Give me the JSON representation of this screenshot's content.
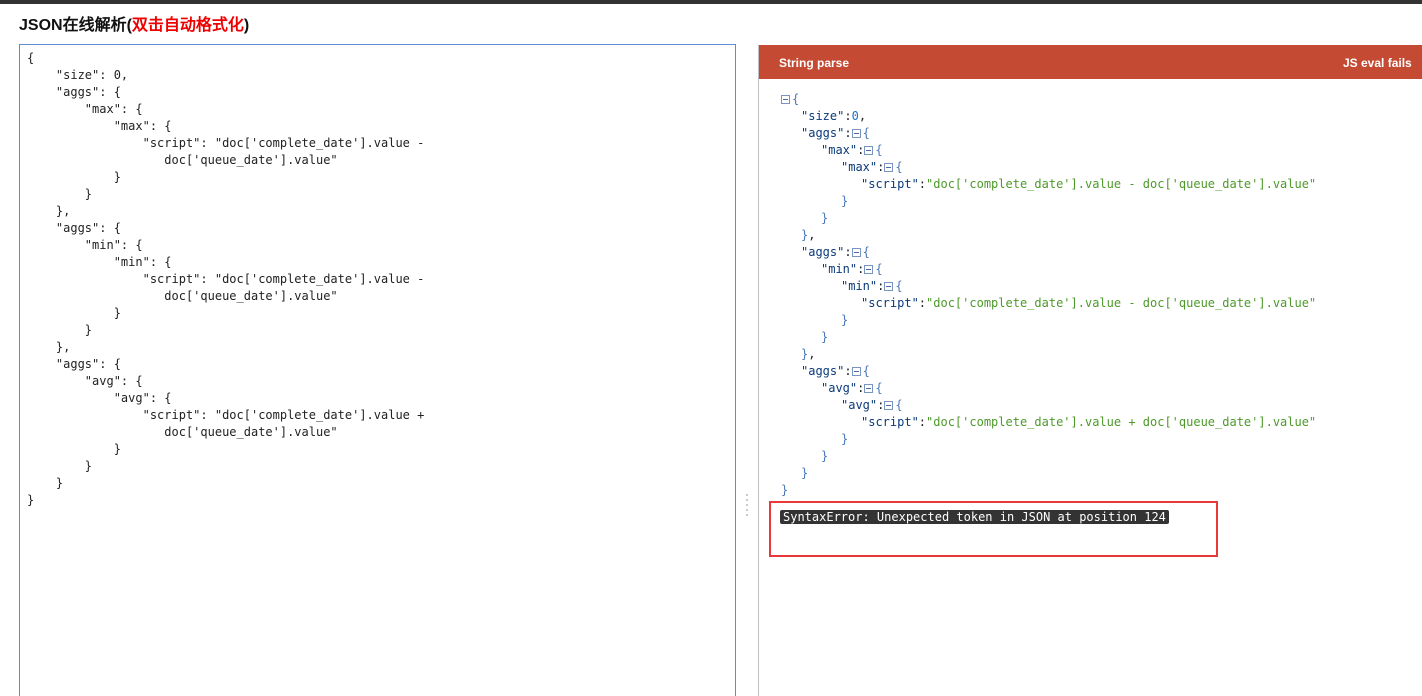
{
  "title": {
    "main": "JSON在线解析(",
    "highlight": "双击自动格式化",
    "suffix": ")"
  },
  "editor": {
    "content": "{\n    \"size\": 0,\n    \"aggs\": {\n        \"max\": {\n            \"max\": {\n                \"script\": \"doc['complete_date'].value -\n                   doc['queue_date'].value\"\n            }\n        }\n    },\n    \"aggs\": {\n        \"min\": {\n            \"min\": {\n                \"script\": \"doc['complete_date'].value -\n                   doc['queue_date'].value\"\n            }\n        }\n    },\n    \"aggs\": {\n        \"avg\": {\n            \"avg\": {\n                \"script\": \"doc['complete_date'].value +\n                   doc['queue_date'].value\"\n            }\n        }\n    }\n}"
  },
  "result": {
    "header_left": "String parse",
    "header_right": "JS eval fails",
    "error": "SyntaxError: Unexpected token in JSON at position 124",
    "colors": {
      "header_bg": "#c44a33",
      "key": "#0a3a7a",
      "string": "#4d9a2a",
      "number": "#1a6fd0",
      "error_border": "#e83838"
    },
    "tree": [
      {
        "indent": 0,
        "toggle": true,
        "open": "{"
      },
      {
        "indent": 1,
        "key": "\"size\"",
        "number": "0",
        "comma": ","
      },
      {
        "indent": 1,
        "key": "\"aggs\"",
        "toggle": true,
        "open": "{"
      },
      {
        "indent": 2,
        "key": "\"max\"",
        "toggle": true,
        "open": "{"
      },
      {
        "indent": 3,
        "key": "\"max\"",
        "toggle": true,
        "open": "{"
      },
      {
        "indent": 4,
        "key": "\"script\"",
        "string": "\"doc['complete_date'].value - doc['queue_date'].value\""
      },
      {
        "indent": 3,
        "close": "}"
      },
      {
        "indent": 2,
        "close": "}"
      },
      {
        "indent": 1,
        "close": "}",
        "comma": ","
      },
      {
        "indent": 1,
        "key": "\"aggs\"",
        "toggle": true,
        "open": "{"
      },
      {
        "indent": 2,
        "key": "\"min\"",
        "toggle": true,
        "open": "{"
      },
      {
        "indent": 3,
        "key": "\"min\"",
        "toggle": true,
        "open": "{"
      },
      {
        "indent": 4,
        "key": "\"script\"",
        "string": "\"doc['complete_date'].value - doc['queue_date'].value\""
      },
      {
        "indent": 3,
        "close": "}"
      },
      {
        "indent": 2,
        "close": "}"
      },
      {
        "indent": 1,
        "close": "}",
        "comma": ","
      },
      {
        "indent": 1,
        "key": "\"aggs\"",
        "toggle": true,
        "open": "{"
      },
      {
        "indent": 2,
        "key": "\"avg\"",
        "toggle": true,
        "open": "{"
      },
      {
        "indent": 3,
        "key": "\"avg\"",
        "toggle": true,
        "open": "{"
      },
      {
        "indent": 4,
        "key": "\"script\"",
        "string": "\"doc['complete_date'].value + doc['queue_date'].value\""
      },
      {
        "indent": 3,
        "close": "}"
      },
      {
        "indent": 2,
        "close": "}"
      },
      {
        "indent": 1,
        "close": "}"
      },
      {
        "indent": 0,
        "close": "}"
      }
    ]
  }
}
